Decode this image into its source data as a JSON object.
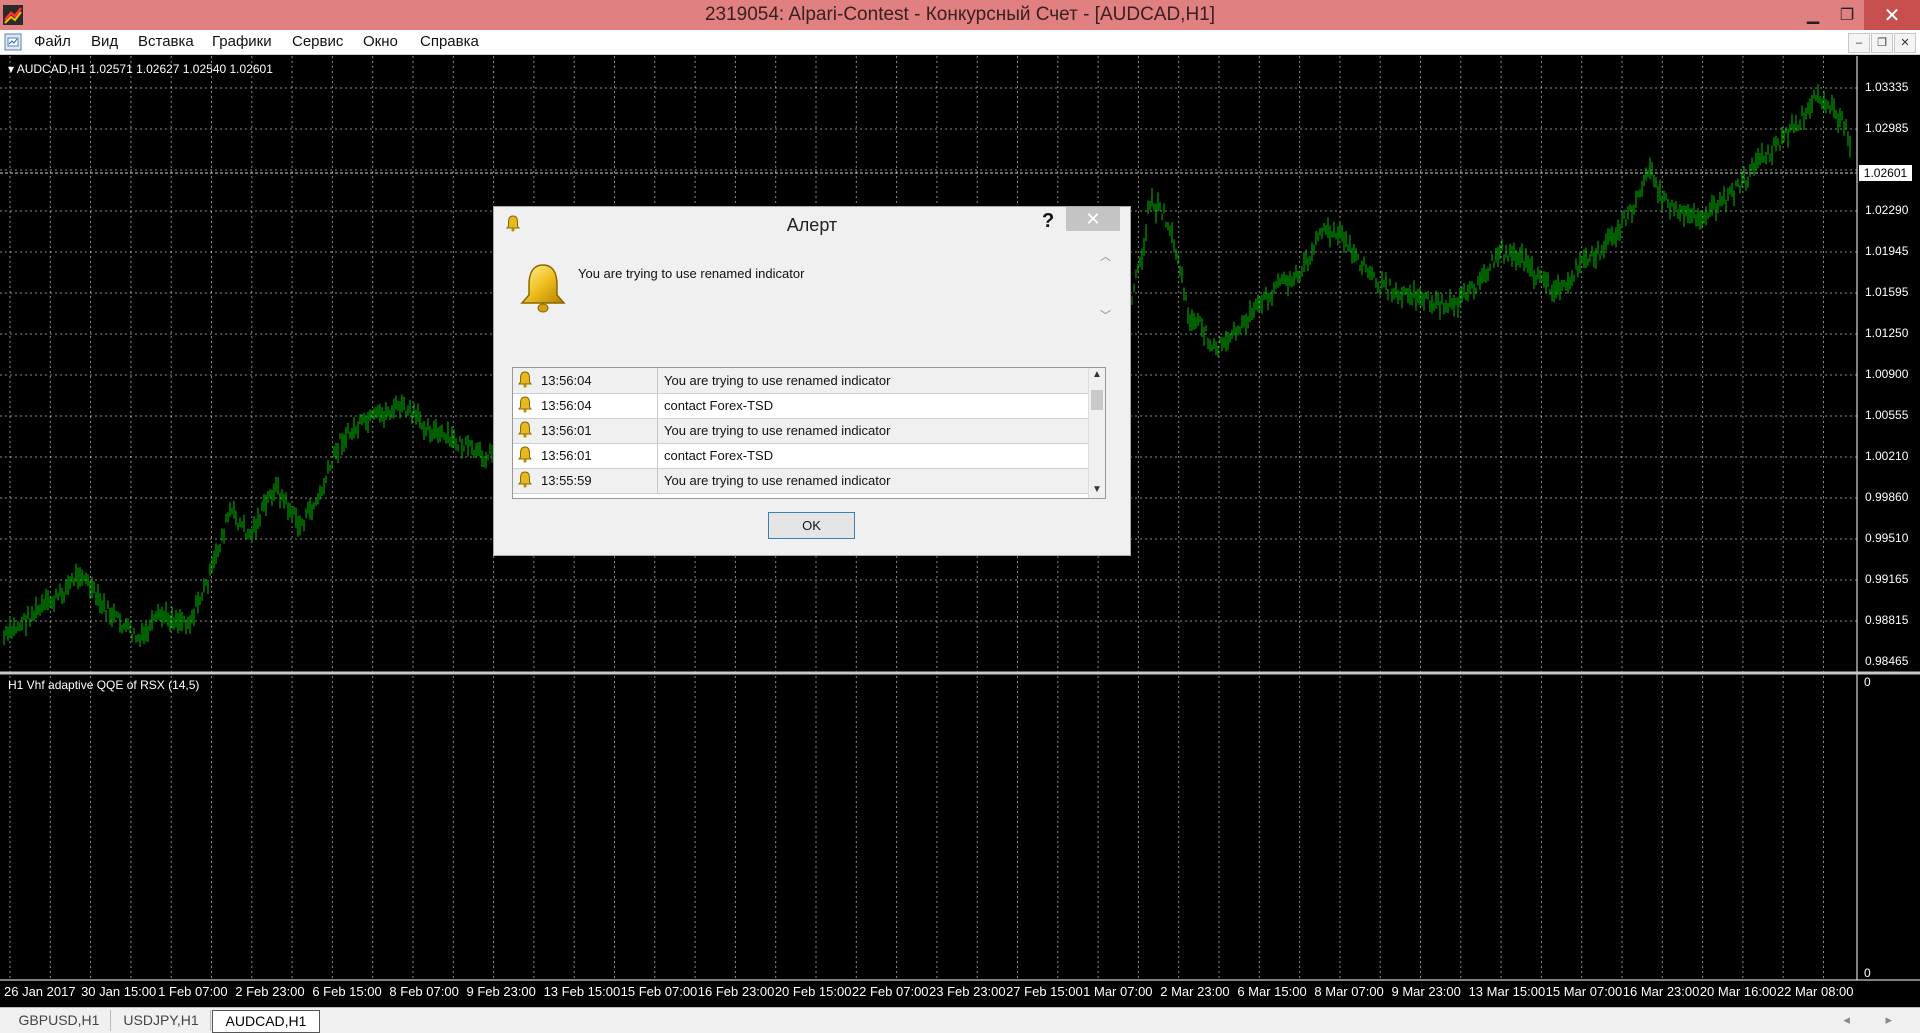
{
  "window": {
    "title": "2319054: Alpari-Contest - Конкурсный Счет - [AUDCAD,H1]",
    "minimize": "▁",
    "restore": "❐",
    "close": "✕"
  },
  "menu": {
    "items": [
      "Файл",
      "Вид",
      "Вставка",
      "Графики",
      "Сервис",
      "Окно",
      "Справка"
    ],
    "mdi_minimize": "–",
    "mdi_restore": "❐",
    "mdi_close": "✕"
  },
  "chart": {
    "symbol_info": "▾ AUDCAD,H1  1.02571 1.02627 1.02540 1.02601",
    "current_price": "1.02601",
    "price_ticks": [
      "1.03335",
      "1.02985",
      "1.02290",
      "1.01945",
      "1.01595",
      "1.01250",
      "1.00900",
      "1.00555",
      "1.00210",
      "0.99860",
      "0.99510",
      "0.99165",
      "0.98815",
      "0.98465"
    ],
    "indicator_label": "H1 Vhf adaptive QQE of RSX (14,5)",
    "indicator_scale_top": "0",
    "indicator_scale_bottom": "0",
    "time_labels": [
      "26 Jan 2017",
      "30 Jan 15:00",
      "1 Feb 07:00",
      "2 Feb 23:00",
      "6 Feb 15:00",
      "8 Feb 07:00",
      "9 Feb 23:00",
      "13 Feb 15:00",
      "15 Feb 07:00",
      "16 Feb 23:00",
      "20 Feb 15:00",
      "22 Feb 07:00",
      "23 Feb 23:00",
      "27 Feb 15:00",
      "1 Mar 07:00",
      "2 Mar 23:00",
      "6 Mar 15:00",
      "8 Mar 07:00",
      "9 Mar 23:00",
      "13 Mar 15:00",
      "15 Mar 07:00",
      "16 Mar 23:00",
      "20 Mar 16:00",
      "22 Mar 08:00"
    ],
    "colors": {
      "bars": "#00c000",
      "grid": "#ffffff",
      "background": "#000000"
    }
  },
  "tabs": [
    {
      "label": "GBPUSD,H1"
    },
    {
      "label": "USDJPY,H1"
    },
    {
      "label": "AUDCAD,H1"
    }
  ],
  "tab_scroll": "◂ ▸",
  "dialog": {
    "title": "Алерт",
    "help": "?",
    "close": "✕",
    "message": "You are trying to use renamed indicator",
    "rows": [
      {
        "time": "13:56:04",
        "message": "You are trying to use renamed indicator"
      },
      {
        "time": "13:56:04",
        "message": "contact Forex-TSD"
      },
      {
        "time": "13:56:01",
        "message": "You are trying to use renamed indicator"
      },
      {
        "time": "13:56:01",
        "message": "contact Forex-TSD"
      },
      {
        "time": "13:55:59",
        "message": "You are trying to use renamed indicator"
      }
    ],
    "ok_label": "OK"
  }
}
